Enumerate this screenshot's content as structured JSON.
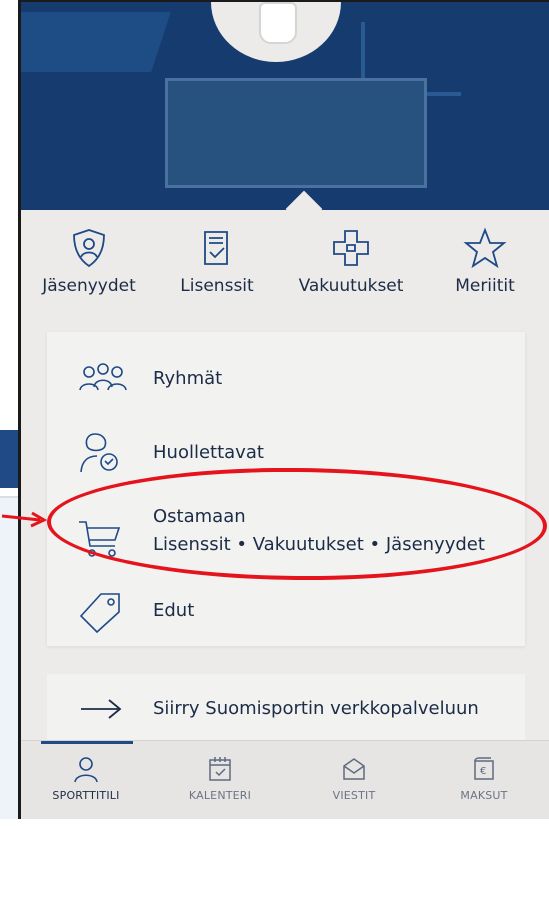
{
  "background_page": {
    "menu_icon": "menu-icon",
    "menu_glyph": "☰"
  },
  "quick_links": [
    {
      "label": "Jäsenyydet",
      "icon": "shield-person-icon"
    },
    {
      "label": "Lisenssit",
      "icon": "document-check-icon"
    },
    {
      "label": "Vakuutukset",
      "icon": "medical-cross-icon"
    },
    {
      "label": "Meriitit",
      "icon": "star-icon"
    }
  ],
  "menu": {
    "items": [
      {
        "label": "Ryhmät",
        "icon": "group-icon"
      },
      {
        "label": "Huollettavat",
        "icon": "dependents-icon"
      },
      {
        "label": "Ostamaan",
        "sublabel": "Lisenssit • Vakuutukset • Jäsenyydet",
        "icon": "cart-icon"
      },
      {
        "label": "Edut",
        "icon": "tag-icon"
      }
    ]
  },
  "external_link": {
    "label": "Siirry Suomisportin verkkopalveluun",
    "icon": "arrow-right-icon"
  },
  "bottom_nav": [
    {
      "label": "SPORTTITILI",
      "icon": "person-icon",
      "active": true
    },
    {
      "label": "KALENTERI",
      "icon": "calendar-icon",
      "active": false
    },
    {
      "label": "VIESTIT",
      "icon": "envelope-icon",
      "active": false
    },
    {
      "label": "MAKSUT",
      "icon": "wallet-icon",
      "active": false
    }
  ],
  "colors": {
    "header": "#163b6e",
    "accent": "#1f4a86",
    "text": "#1d2c46",
    "annotation": "#e5141c"
  }
}
